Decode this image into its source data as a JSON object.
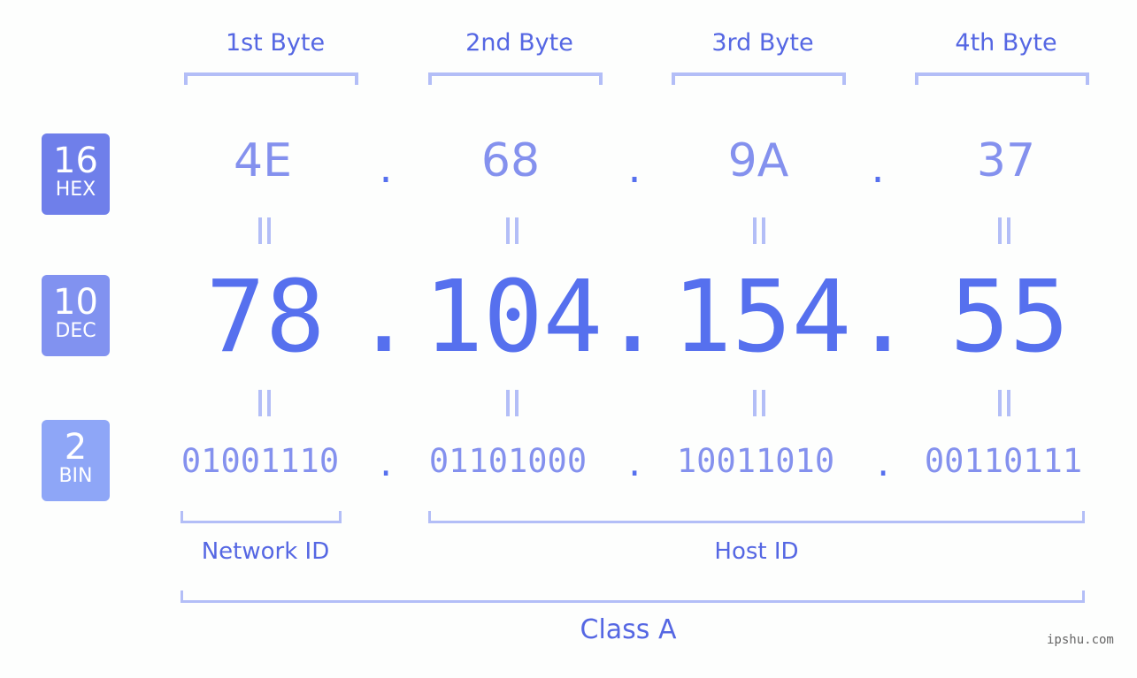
{
  "byte_headers": [
    "1st Byte",
    "2nd Byte",
    "3rd Byte",
    "4th Byte"
  ],
  "bases": [
    {
      "num": "16",
      "name": "HEX",
      "color": "#6f7fea"
    },
    {
      "num": "10",
      "name": "DEC",
      "color": "#8192f0"
    },
    {
      "num": "2",
      "name": "BIN",
      "color": "#8ea6f7"
    }
  ],
  "hex_values": [
    "4E",
    "68",
    "9A",
    "37"
  ],
  "dec_values": [
    "78",
    "104",
    "154",
    "55"
  ],
  "bin_values": [
    "01001110",
    "01101000",
    "10011010",
    "00110111"
  ],
  "separator": ".",
  "network_id_label": "Network ID",
  "host_id_label": "Host ID",
  "class_label": "Class A",
  "watermark": "ipshu.com",
  "colors": {
    "primary": "#5567e3",
    "accent_dot": "#5670ee",
    "bracket": "#b3bef7",
    "hex_bin_text": "#8491ee"
  }
}
